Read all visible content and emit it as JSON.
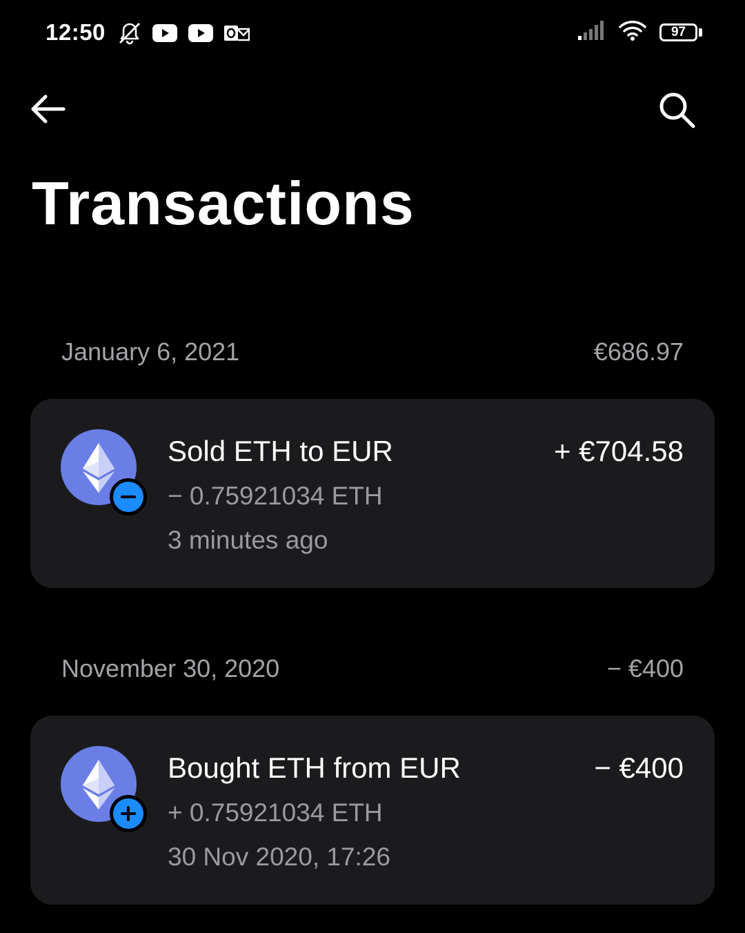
{
  "status_bar": {
    "time": "12:50",
    "battery": "97",
    "icons_left": [
      "mute-icon",
      "youtube-icon",
      "youtube-icon",
      "outlook-icon"
    ],
    "icons_right": [
      "signal-icon",
      "wifi-icon",
      "battery-icon"
    ]
  },
  "header": {
    "back_icon": "arrow-left-icon",
    "search_icon": "search-icon",
    "title": "Transactions"
  },
  "colors": {
    "background": "#000000",
    "card": "#1b1b1e",
    "muted_text": "#9a9ba0",
    "eth_coin": "#6a7ee6",
    "badge_blue": "#1a8cff"
  },
  "groups": [
    {
      "date": "January 6, 2021",
      "total": "€686.97",
      "transactions": [
        {
          "icon": "eth-coin-icon",
          "badge": "minus-icon",
          "title": "Sold ETH to EUR",
          "amount": "+ €704.58",
          "crypto_amount": "− 0.75921034 ETH",
          "time": "3 minutes ago"
        }
      ]
    },
    {
      "date": "November 30, 2020",
      "total": "− €400",
      "transactions": [
        {
          "icon": "eth-coin-icon",
          "badge": "plus-icon",
          "title": "Bought ETH from EUR",
          "amount": "− €400",
          "crypto_amount": "+ 0.75921034 ETH",
          "time": "30 Nov 2020, 17:26"
        }
      ]
    }
  ]
}
